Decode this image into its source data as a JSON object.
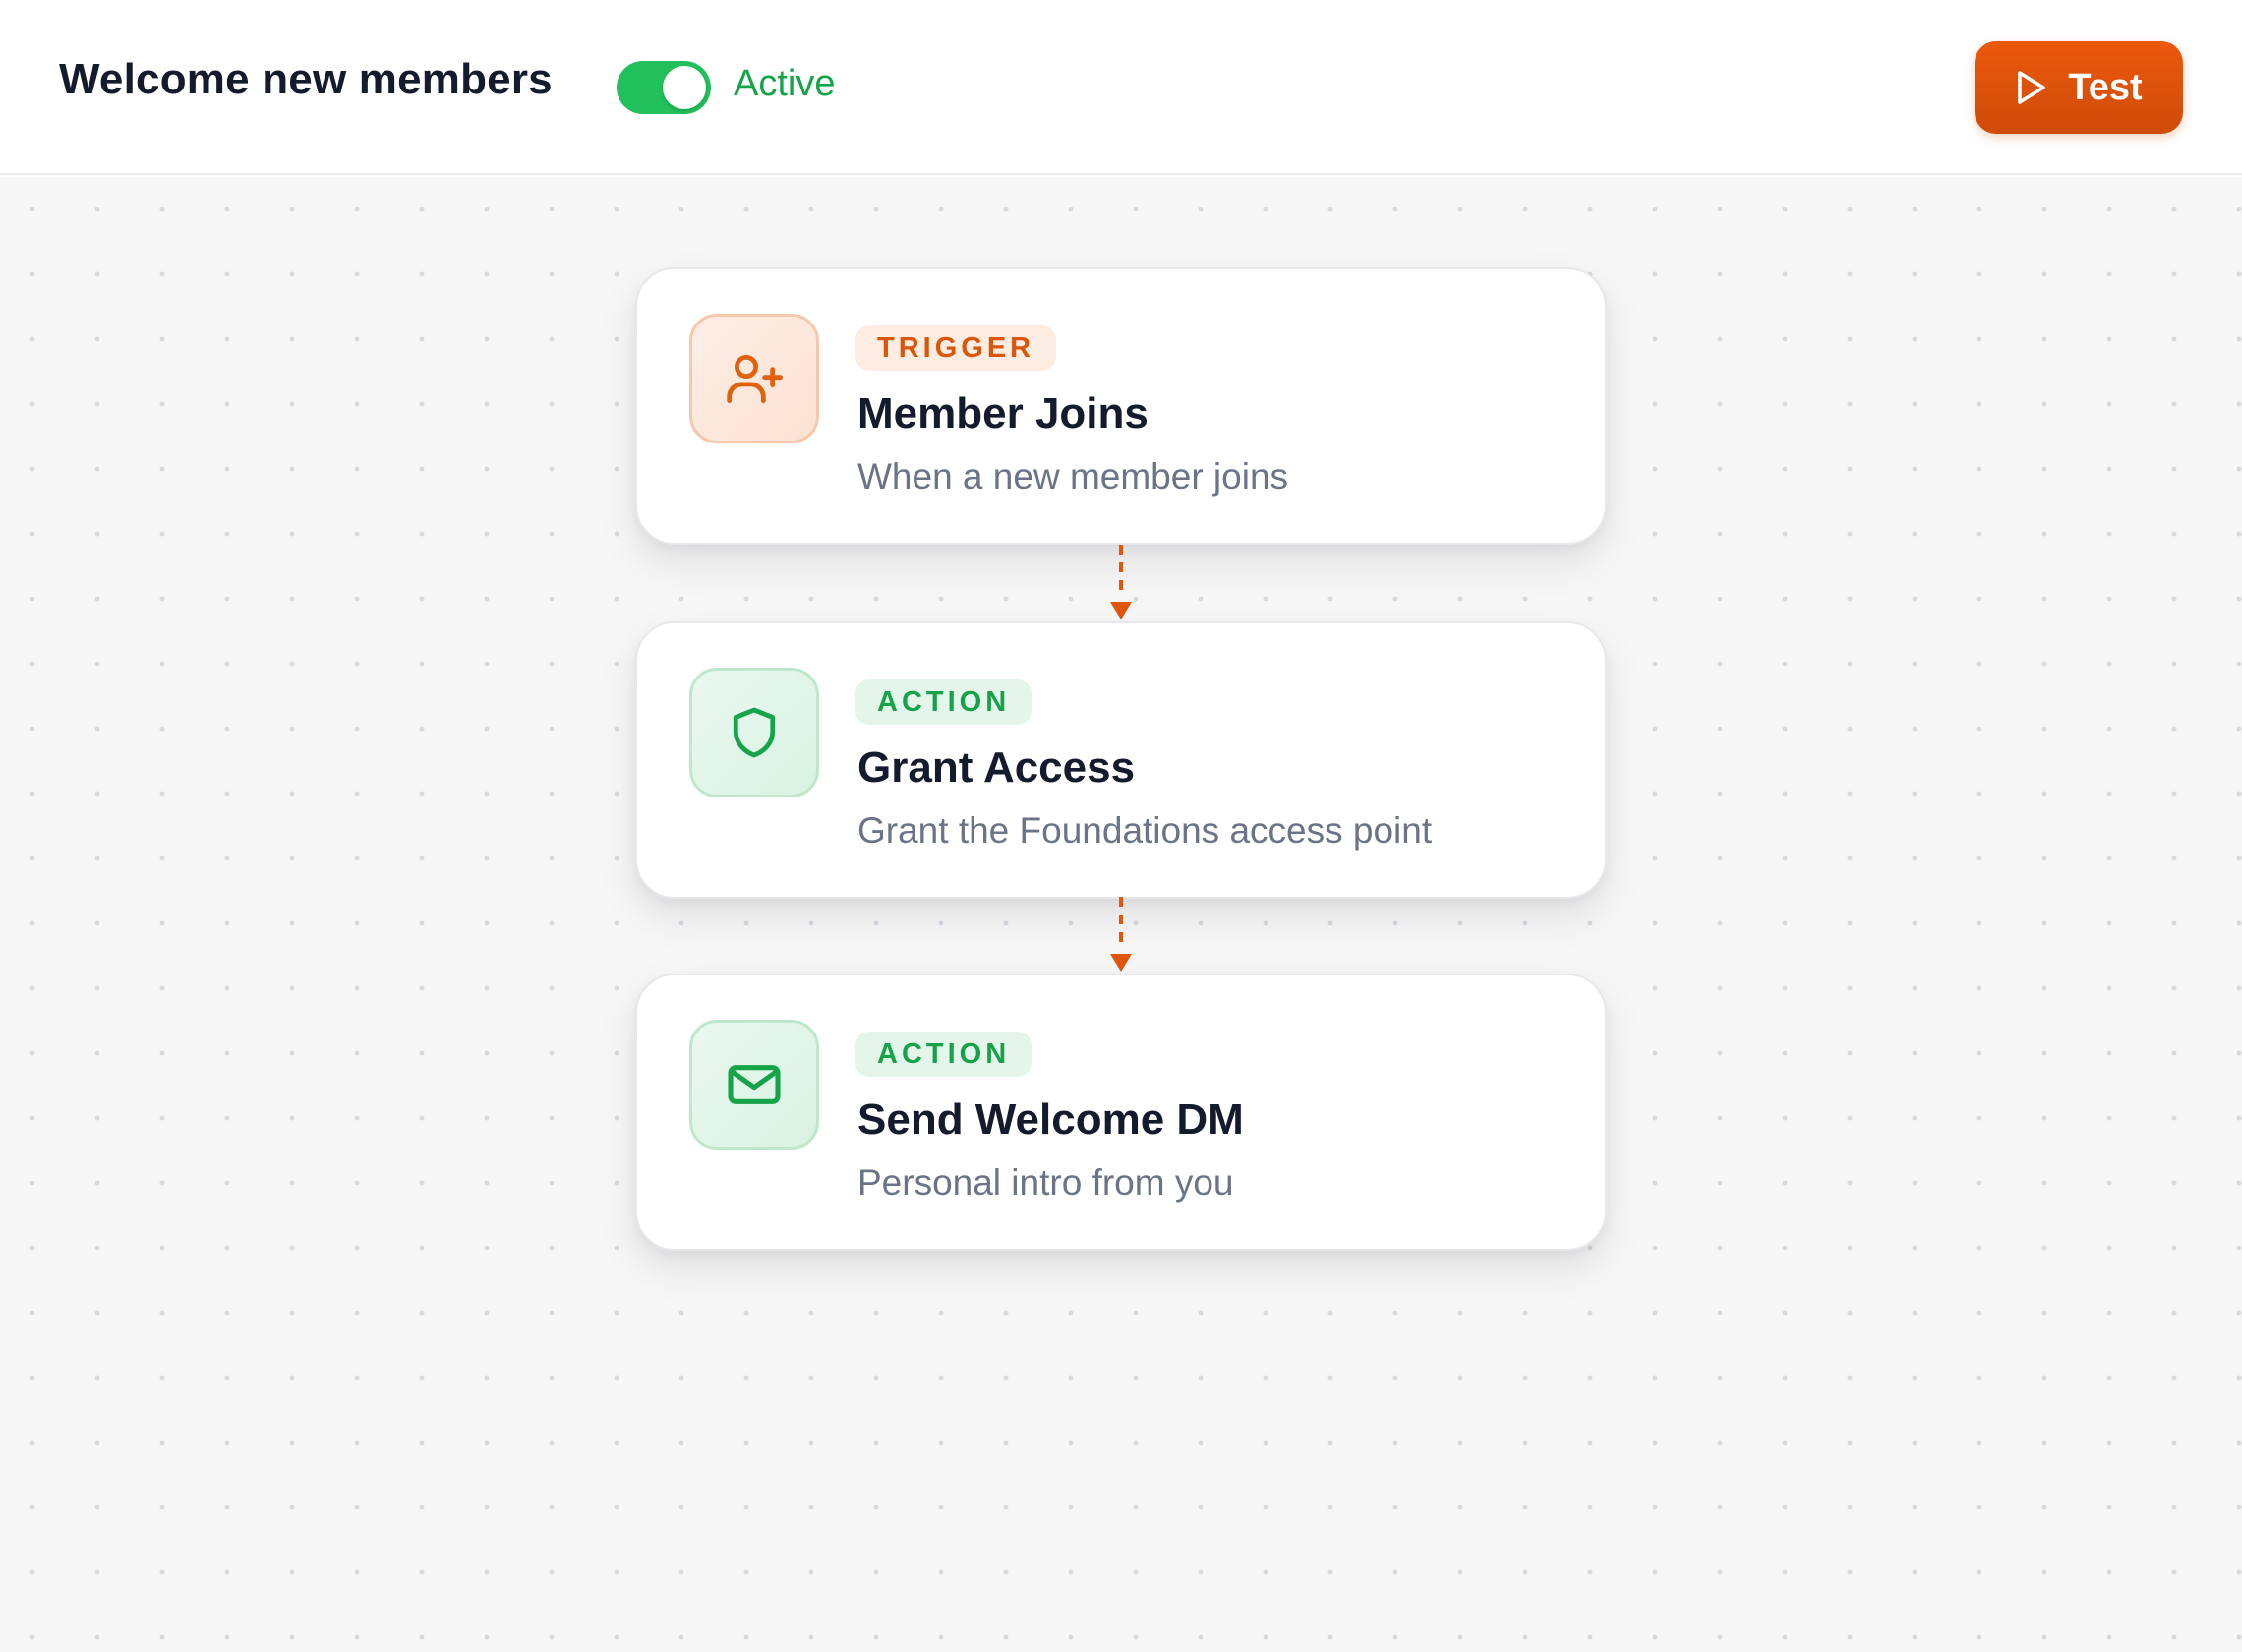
{
  "header": {
    "title": "Welcome new members",
    "toggle_on": true,
    "status": "Active",
    "test_label": "Test"
  },
  "colors": {
    "accent": "#ea580c",
    "active_green": "#22c05b",
    "action_green": "#17a24a",
    "title_text": "#141b2d",
    "muted_text": "#6b7486"
  },
  "flow": {
    "nodes": [
      {
        "pill": "TRIGGER",
        "title": "Member Joins",
        "subtitle": "When a new member joins",
        "icon": "user-plus-icon",
        "tone": "orange"
      },
      {
        "pill": "ACTION",
        "title": "Grant Access",
        "subtitle": "Grant the Foundations access point",
        "icon": "shield-icon",
        "tone": "green"
      },
      {
        "pill": "ACTION",
        "title": "Send Welcome DM",
        "subtitle": "Personal intro from you",
        "icon": "mail-icon",
        "tone": "green"
      }
    ]
  }
}
